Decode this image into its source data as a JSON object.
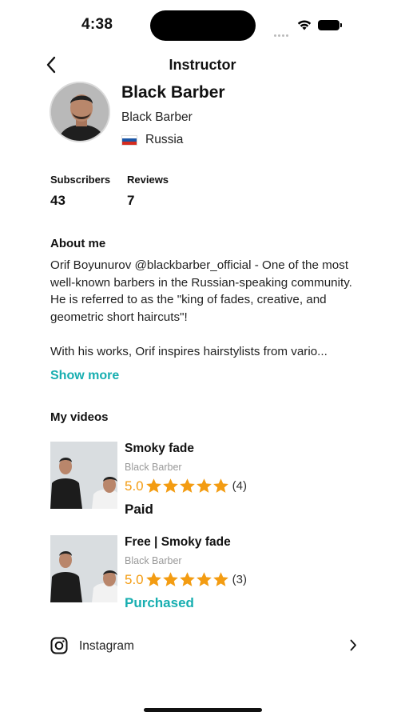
{
  "status_bar": {
    "time": "4:38"
  },
  "nav": {
    "title": "Instructor",
    "back_icon": "chevron-left-icon"
  },
  "profile": {
    "name": "Black Barber",
    "subname": "Black Barber",
    "country": "Russia",
    "flag_colors": [
      "#ffffff",
      "#1c57a7",
      "#d52b1e"
    ]
  },
  "stats": [
    {
      "label": "Subscribers",
      "value": "43"
    },
    {
      "label": "Reviews",
      "value": "7"
    }
  ],
  "about": {
    "title": "About me",
    "text": "Orif Boyunurov @blackbarber_official - One of the most well-known barbers in the Russian-speaking community. He is referred to as the \"king of fades, creative, and geometric short haircuts\"!\n\nWith his works, Orif inspires hairstylists from vario...",
    "show_more": "Show more"
  },
  "videos_section": {
    "title": "My videos"
  },
  "videos": [
    {
      "title": "Smoky fade",
      "author": "Black Barber",
      "rating": "5.0",
      "stars": 5,
      "count": "(4)",
      "status": "Paid",
      "status_color": "#111111"
    },
    {
      "title": "Free | Smoky fade",
      "author": "Black Barber",
      "rating": "5.0",
      "stars": 5,
      "count": "(3)",
      "status": "Purchased",
      "status_color": "#17aeb0"
    }
  ],
  "social": {
    "label": "Instagram",
    "icon": "instagram-icon"
  },
  "colors": {
    "accent": "#17aeb0",
    "star": "#f39c12"
  }
}
